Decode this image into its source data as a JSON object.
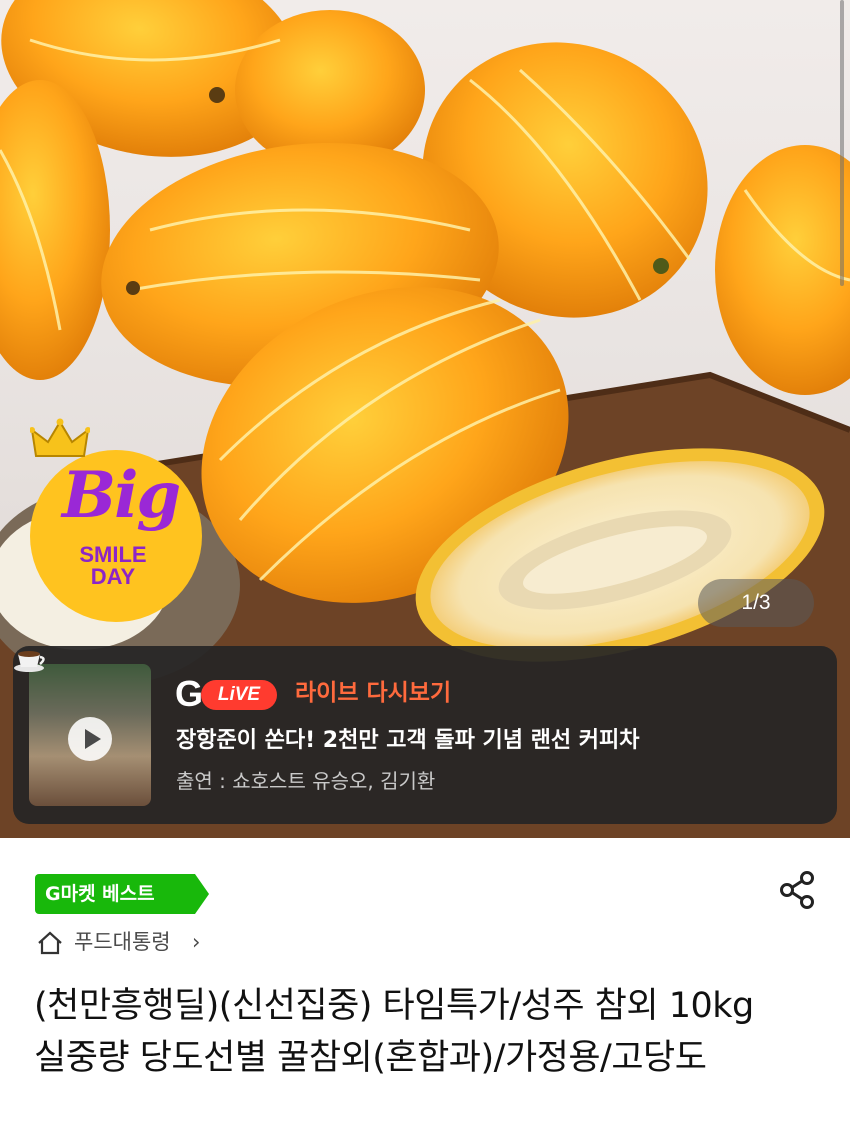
{
  "hero": {
    "pager": "1/3",
    "badge": {
      "big": "Big",
      "smile": "SMILE",
      "day": "DAY"
    }
  },
  "live": {
    "logo_letter": "G",
    "logo_pill": "LiVE",
    "label": "라이브 다시보기",
    "title": "장항준이 쏜다! 2천만 고객 돌파 기념 랜선 커피차",
    "cast": "출연 : 쇼호스트 유승오, 김기환"
  },
  "product": {
    "best_badge": "G마켓 베스트",
    "breadcrumb": "푸드대통령",
    "breadcrumb_chevron": "›",
    "title": "(천만흥행딜)(신선집중) 타임특가/성주 참외 10kg 실중량 당도선별 꿀참외(혼합과)/가정용/고당도"
  },
  "colors": {
    "live_accent": "#ff6a3d",
    "live_pill": "#ff3b2f",
    "best_green": "#18b80b",
    "badge_yellow": "#ffc31f",
    "badge_purple": "#9a28d6"
  }
}
